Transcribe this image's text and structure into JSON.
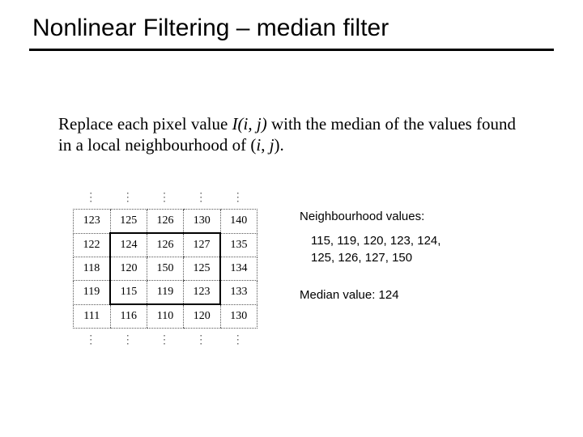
{
  "title": "Nonlinear Filtering – median filter",
  "body": {
    "prefix": "Replace each pixel value ",
    "Iij": "I(i, j)",
    "mid": " with the median of the values found in a local neighbourhood of (",
    "i": "i",
    "comma": ", ",
    "j": "j",
    "suffix": ")."
  },
  "grid": {
    "r0": [
      "123",
      "125",
      "126",
      "130",
      "140"
    ],
    "r1": [
      "122",
      "124",
      "126",
      "127",
      "135"
    ],
    "r2": [
      "118",
      "120",
      "150",
      "125",
      "134"
    ],
    "r3": [
      "119",
      "115",
      "119",
      "123",
      "133"
    ],
    "r4": [
      "111",
      "116",
      "110",
      "120",
      "130"
    ]
  },
  "side": {
    "label1": "Neighbourhood values:",
    "vals_line1": "115, 119, 120, 123, 124,",
    "vals_line2": "125, 126, 127, 150",
    "label2": "Median value: 124"
  },
  "dots": "⋮"
}
